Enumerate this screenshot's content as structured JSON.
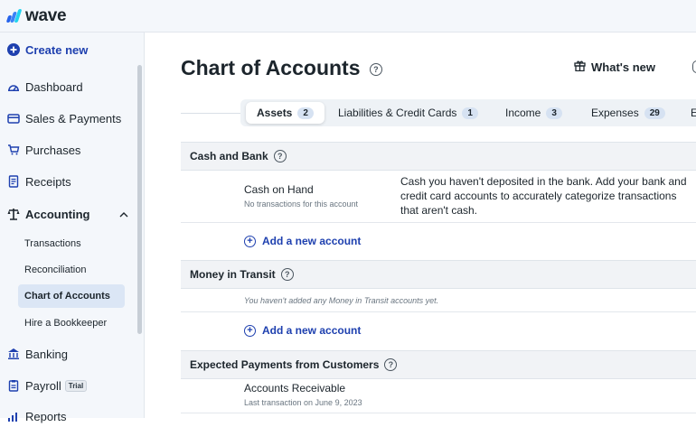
{
  "app": {
    "name": "wave",
    "accent": "#1e40af",
    "logo_colors": [
      "#2563eb",
      "#60a5fa",
      "#22d3ee"
    ]
  },
  "sidebar": {
    "create_new": "Create new",
    "items": [
      {
        "label": "Dashboard",
        "icon": "dashboard-icon"
      },
      {
        "label": "Sales & Payments",
        "icon": "card-icon"
      },
      {
        "label": "Purchases",
        "icon": "cart-icon"
      },
      {
        "label": "Receipts",
        "icon": "receipt-icon"
      },
      {
        "label": "Accounting",
        "icon": "scale-icon"
      },
      {
        "label": "Banking",
        "icon": "bank-icon"
      },
      {
        "label": "Payroll",
        "icon": "clipboard-icon",
        "badge": "Trial"
      },
      {
        "label": "Reports",
        "icon": "chart-icon"
      }
    ],
    "accounting_sub": [
      {
        "label": "Transactions"
      },
      {
        "label": "Reconciliation"
      },
      {
        "label": "Chart of Accounts",
        "active": true
      },
      {
        "label": "Hire a Bookkeeper"
      }
    ]
  },
  "main": {
    "title": "Chart of Accounts",
    "whats_new": "What's new",
    "tabs": [
      {
        "label": "Assets",
        "count": "2",
        "active": true
      },
      {
        "label": "Liabilities & Credit Cards",
        "count": "1"
      },
      {
        "label": "Income",
        "count": "3"
      },
      {
        "label": "Expenses",
        "count": "29"
      },
      {
        "label": "E"
      }
    ],
    "sections": [
      {
        "title": "Cash and Bank",
        "account": {
          "name": "Cash on Hand",
          "sub": "No transactions for this account",
          "desc": "Cash you haven't deposited in the bank. Add your bank and credit card accounts to accurately categorize transactions that aren't cash."
        },
        "add_label": "Add a new account"
      },
      {
        "title": "Money in Transit",
        "empty": "You haven't added any Money in Transit accounts yet.",
        "add_label": "Add a new account"
      },
      {
        "title": "Expected Payments from Customers",
        "account": {
          "name": "Accounts Receivable",
          "sub": "Last transaction on June 9, 2023"
        }
      }
    ]
  }
}
